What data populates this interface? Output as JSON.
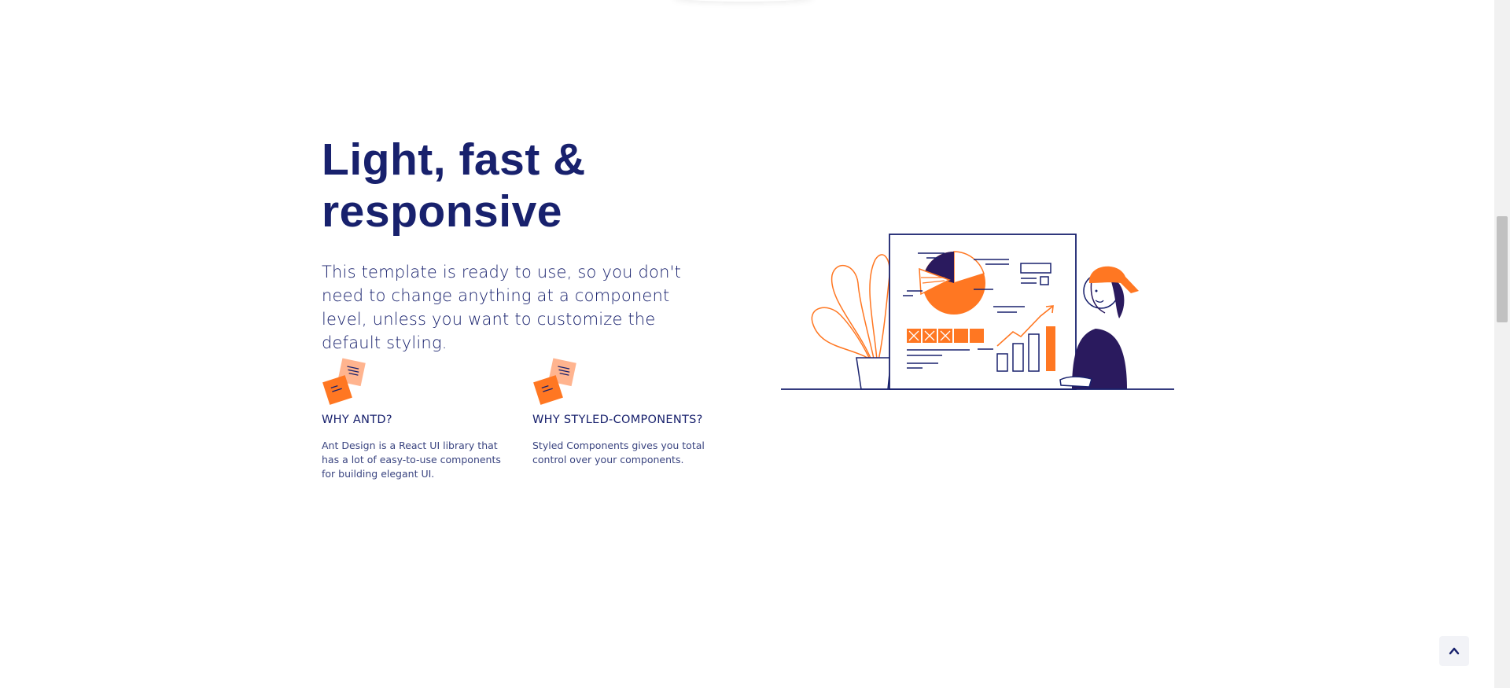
{
  "section": {
    "title": "Light, fast & responsive",
    "content": "This template is ready to use, so you don't need to change anything at a component level, unless you want to customize the default styling.",
    "features": [
      {
        "title": "WHY ANTD?",
        "content": "Ant Design is a React UI library that has a lot of easy-to-use components for building elegant UI.",
        "icon": "notes-icon"
      },
      {
        "title": "WHY STYLED-COMPONENTS?",
        "content": "Styled Components gives you total control over your components.",
        "icon": "notes-icon"
      }
    ],
    "illustration": "dashboard-illustration"
  },
  "scroll_up": {
    "icon": "chevron-up-icon"
  },
  "colors": {
    "primary": "#18216d",
    "accent": "#ff7722",
    "accent_light": "#ffb48f",
    "background": "#ffffff"
  }
}
